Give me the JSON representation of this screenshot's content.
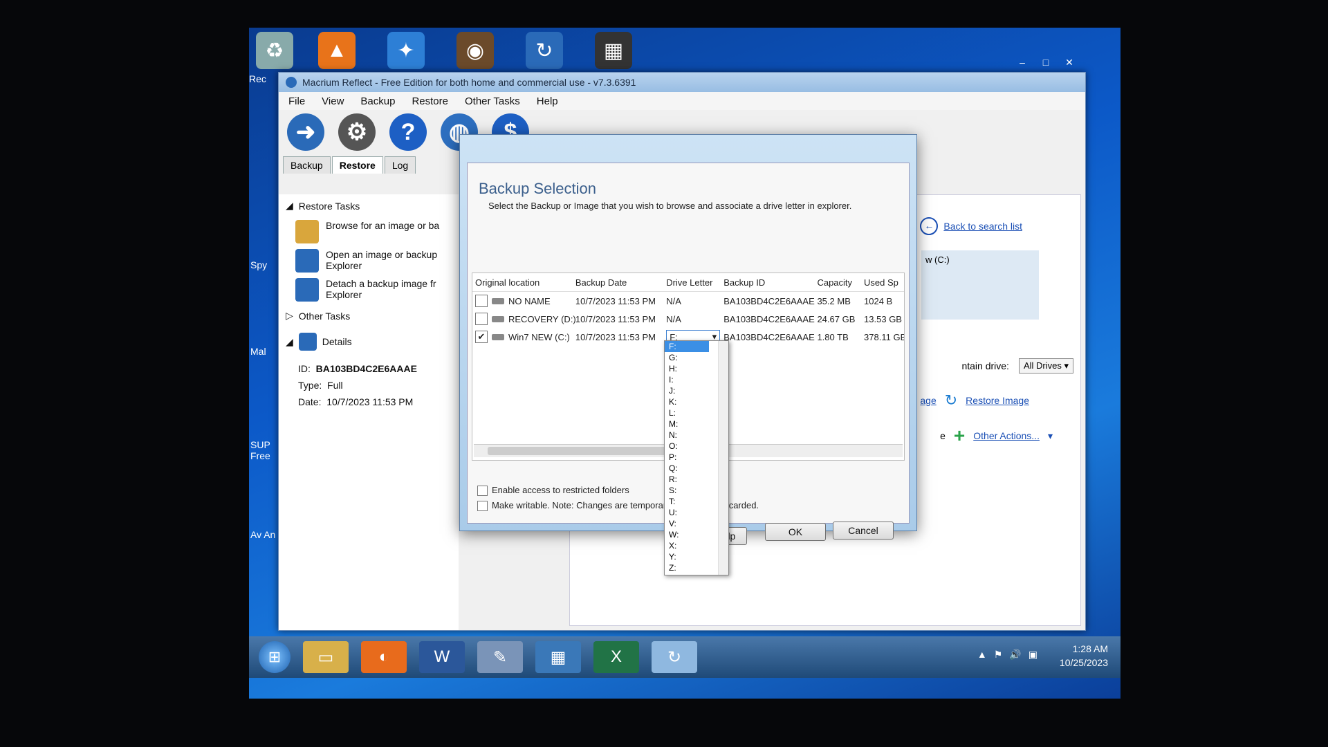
{
  "desktop": {
    "label_recycle": "Rec",
    "label_spy": "Spy",
    "label_mal": "Mal",
    "label_sup": "SUP Free",
    "label_av": "Av An"
  },
  "app": {
    "title": "Macrium Reflect - Free Edition for both home and commercial use - v7.3.6391",
    "menu": [
      "File",
      "View",
      "Backup",
      "Restore",
      "Other Tasks",
      "Help"
    ],
    "tabs": [
      "Backup",
      "Restore",
      "Log"
    ],
    "restore_tasks_heading": "Restore Tasks",
    "tasks": [
      {
        "line1": "Browse for an image or ba",
        "line2": ""
      },
      {
        "line1": "Open an image or backup",
        "line2": "Explorer"
      },
      {
        "line1": "Detach a backup image fr",
        "line2": "Explorer"
      }
    ],
    "other_tasks_heading": "Other Tasks",
    "details_heading": "Details",
    "details": {
      "id_label": "ID:",
      "id_value": "BA103BD4C2E6AAAE",
      "type_label": "Type:",
      "type_value": "Full",
      "date_label": "Date:",
      "date_value": "10/7/2023 11:53 PM"
    },
    "right": {
      "back_link": "Back to search list",
      "drive_partial": "w (C:)",
      "contain_drive_label": "ntain drive:",
      "all_drives": "All Drives",
      "restore_image": "Restore Image",
      "other_actions": "Other Actions...",
      "age_partial": "age",
      "e_partial": "e"
    }
  },
  "dialog": {
    "title": "Backup Selection",
    "description": "Select the Backup or Image that you wish to browse and associate a drive letter in explorer.",
    "columns": [
      "Original location",
      "Backup Date",
      "Drive Letter",
      "Backup ID",
      "Capacity",
      "Used Sp"
    ],
    "rows": [
      {
        "checked": false,
        "location": "NO NAME",
        "date": "10/7/2023 11:53 PM",
        "letter": "N/A",
        "id": "BA103BD4C2E6AAAE",
        "capacity": "35.2 MB",
        "used": "1024 B"
      },
      {
        "checked": false,
        "location": "RECOVERY (D:)",
        "date": "10/7/2023 11:53 PM",
        "letter": "N/A",
        "id": "BA103BD4C2E6AAAE",
        "capacity": "24.67 GB",
        "used": "13.53 GB"
      },
      {
        "checked": true,
        "location": "Win7 NEW (C:)",
        "date": "10/7/2023 11:53 PM",
        "letter": "F:",
        "id": "BA103BD4C2E6AAAE",
        "capacity": "1.80 TB",
        "used": "378.11 GB"
      }
    ],
    "dropdown_options": [
      "F:",
      "G:",
      "H:",
      "I:",
      "J:",
      "K:",
      "L:",
      "M:",
      "N:",
      "O:",
      "P:",
      "Q:",
      "R:",
      "S:",
      "T:",
      "U:",
      "V:",
      "W:",
      "X:",
      "Y:",
      "Z:"
    ],
    "option_restricted": "Enable access to restricted folders",
    "option_writable": "Make writable. Note: Changes are temporar",
    "discarded_partial": "scarded.",
    "help_partial": "elp",
    "ok": "OK",
    "cancel": "Cancel"
  },
  "taskbar": {
    "time": "1:28 AM",
    "date": "10/25/2023"
  }
}
